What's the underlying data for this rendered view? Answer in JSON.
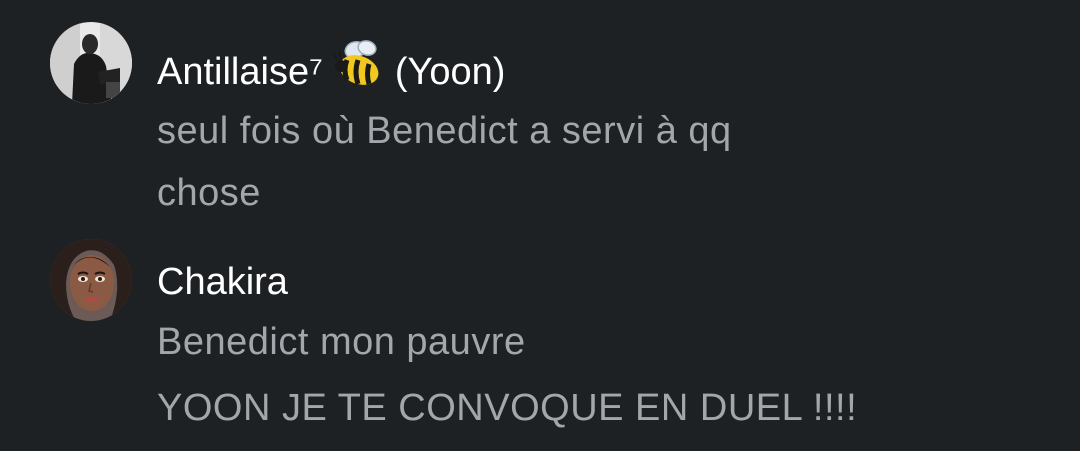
{
  "messages": [
    {
      "author": "Antillaise⁷",
      "author_suffix": "(Yoon)",
      "author_emoji_icon": "bee-icon",
      "lines": [
        "seul fois où Benedict a servi à qq",
        "chose"
      ]
    },
    {
      "author": "Chakira",
      "lines": [
        "Benedict mon pauvre",
        "YOON JE TE CONVOQUE EN DUEL !!!!"
      ]
    }
  ],
  "colors": {
    "background": "#1e2124",
    "author": "#ffffff",
    "message_text": "#a3a6aa"
  }
}
